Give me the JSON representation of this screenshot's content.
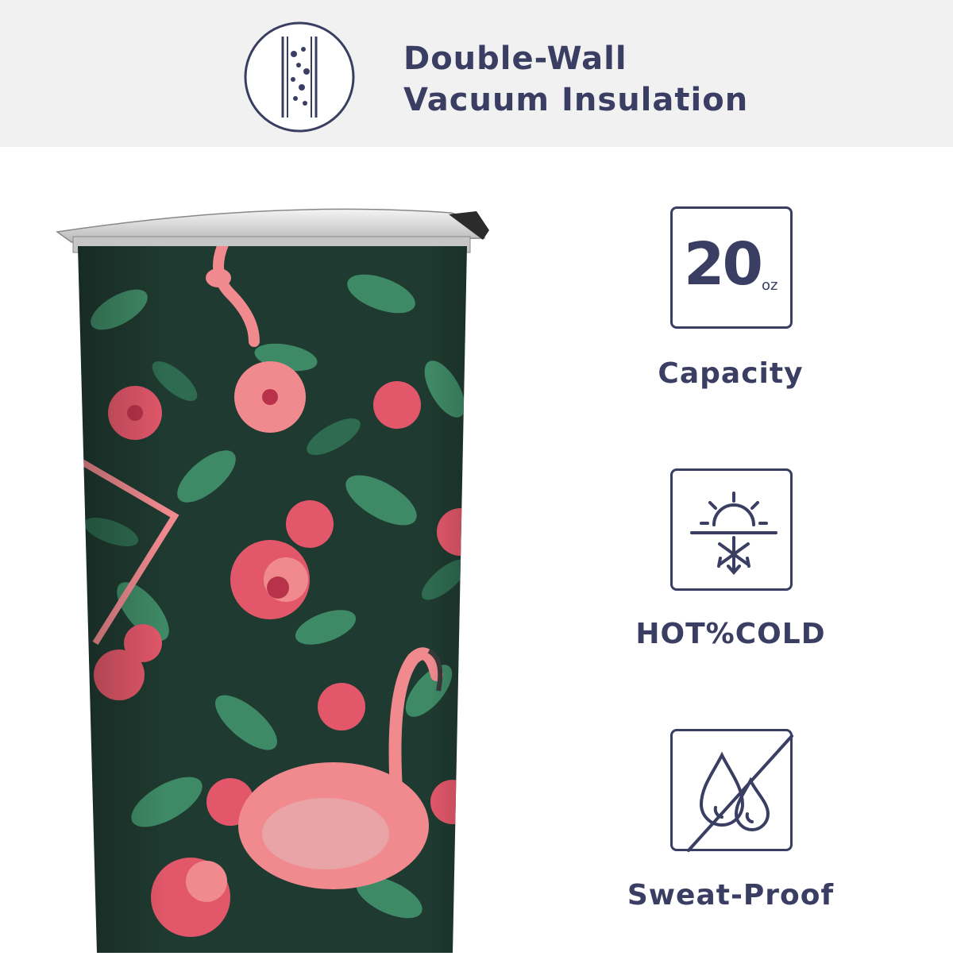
{
  "banner": {
    "icon": "double-wall-insulation-icon",
    "line1": "Double-Wall",
    "line2": "Vacuum Insulation"
  },
  "product": {
    "image": "flamingo-tropical-tumbler"
  },
  "features": [
    {
      "icon": "capacity-20oz-icon",
      "big": "20",
      "small": "oz",
      "label": "Capacity"
    },
    {
      "icon": "sun-snowflake-icon",
      "label": "HOT%COLD"
    },
    {
      "icon": "no-water-drops-icon",
      "label": "Sweat-Proof"
    }
  ],
  "colors": {
    "accent": "#3a3e63",
    "banner_bg": "#f1f1f1",
    "tumbler_bg": "#1f3a30",
    "flower": "#e2586a",
    "flamingo": "#f08a8f",
    "leaf": "#3f8a66"
  }
}
